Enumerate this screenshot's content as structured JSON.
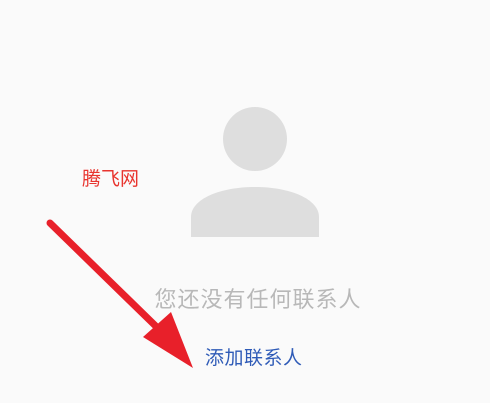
{
  "empty_state": {
    "icon": "person-placeholder-icon",
    "message": "您还没有任何联系人",
    "action_label": "添加联系人"
  },
  "watermark": {
    "text": "腾飞网"
  },
  "colors": {
    "background": "#fafafa",
    "icon": "#dedede",
    "message": "#b8b8b8",
    "action": "#2f5bb7",
    "watermark": "#e8342e",
    "arrow": "#e8202a"
  }
}
